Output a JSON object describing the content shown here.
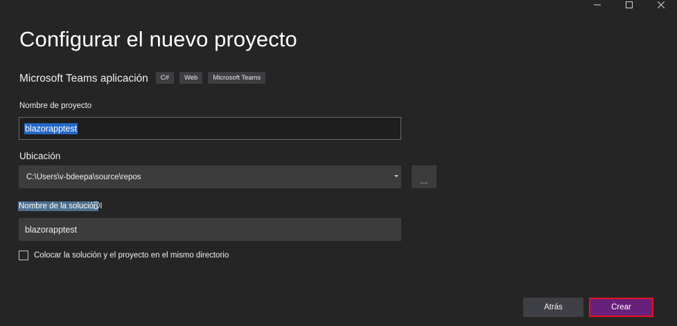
{
  "window": {
    "minimize_glyph": "—",
    "maximize_icon": "maximize-icon",
    "close_glyph": "✕"
  },
  "page": {
    "title": "Configurar el nuevo proyecto"
  },
  "template": {
    "name": "Microsoft Teams aplicación",
    "tags": [
      "C#",
      "Web",
      "Microsoft Teams"
    ]
  },
  "project_name": {
    "label": "Nombre de proyecto",
    "value": "blazorapptest"
  },
  "location": {
    "label": "Ubicación",
    "value": "C:\\Users\\v-bdeepa\\source\\repos",
    "browse_label": "..."
  },
  "solution_name": {
    "label": "Nombre de la solución",
    "cursor": "I",
    "value": "blazorapptest"
  },
  "same_directory": {
    "label": "Colocar la solución y el proyecto en el mismo directorio",
    "checked": false
  },
  "footer": {
    "back_label": "Atrás",
    "create_label": "Crear"
  },
  "colors": {
    "background": "#252526",
    "input_bg": "#3c3c3c",
    "selection": "#2668c6",
    "primary_button": "#68217a",
    "highlight_border": "#e81123"
  }
}
